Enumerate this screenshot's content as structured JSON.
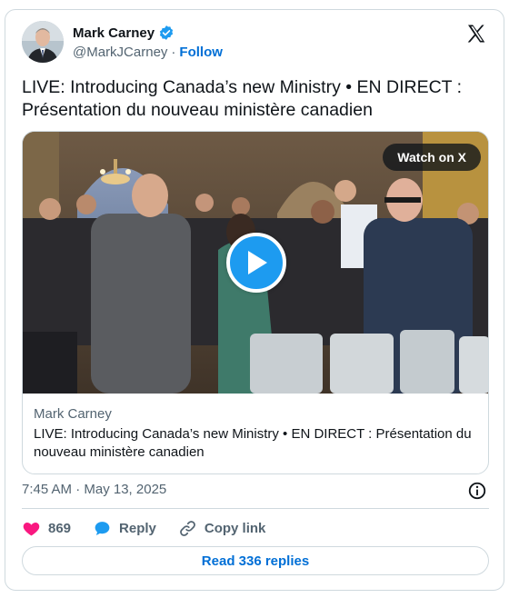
{
  "author": {
    "display_name": "Mark Carney",
    "handle": "@MarkJCarney",
    "separator": "·",
    "follow_label": "Follow",
    "verified": true
  },
  "tweet": {
    "text": "LIVE: Introducing Canada’s new Ministry • EN DIRECT : Présentation du nouveau ministère canadien",
    "timestamp": "7:45 AM · May 13, 2025"
  },
  "media": {
    "watch_label": "Watch on X",
    "card_source": "Mark Carney",
    "card_title": "LIVE: Introducing Canada’s new Ministry • EN DIRECT : Présentation du nouveau ministère canadien"
  },
  "actions": {
    "like_count": "869",
    "reply_label": "Reply",
    "copy_link_label": "Copy link"
  },
  "replies_button": "Read 336 replies",
  "colors": {
    "like": "#f91880",
    "reply": "#1d9bf0",
    "link": "#006fd6",
    "play": "#1d9bf0"
  },
  "icons": [
    "verified-badge-icon",
    "x-logo-icon",
    "play-icon",
    "info-icon",
    "heart-icon",
    "reply-bubble-icon",
    "link-icon"
  ]
}
